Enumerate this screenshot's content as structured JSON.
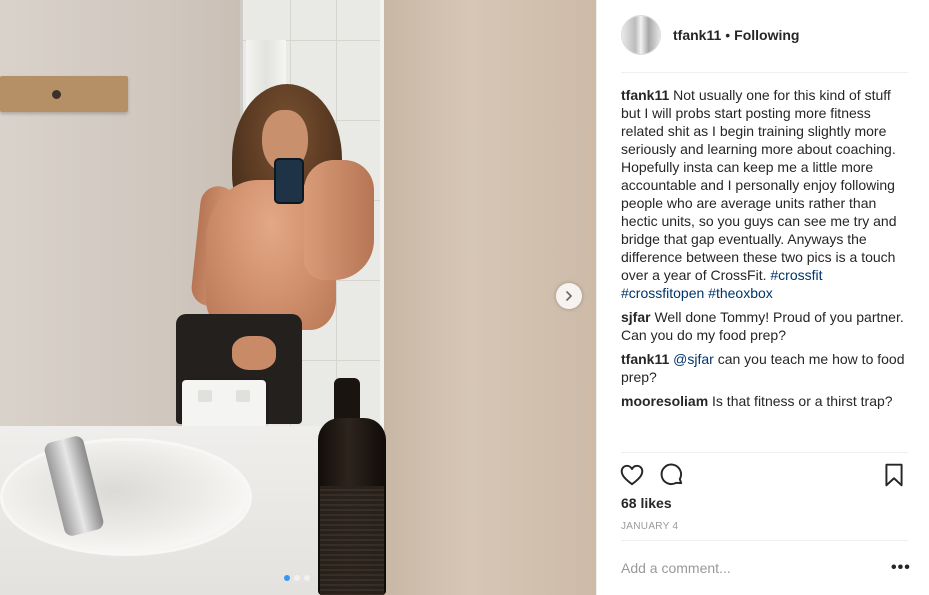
{
  "post": {
    "username": "tfank11",
    "separator": "•",
    "follow_status": "Following",
    "likes": "68 likes",
    "date": "JANUARY 4",
    "add_comment_placeholder": "Add a comment...",
    "more_options": "•••",
    "carousel_dots": 3,
    "carousel_active_index": 0
  },
  "caption": {
    "user": "tfank11",
    "text": "Not usually one for this kind of stuff but I will probs start posting more fitness related shit as I begin training slightly more seriously and learning more about coaching. Hopefully insta can keep me a little more accountable and I personally enjoy following people who are average units rather than hectic units, so you guys can see me try and bridge that gap eventually. Anyways the difference between these two pics is a touch over a year of CrossFit.",
    "tags": [
      "#crossfit",
      "#crossfitopen",
      "#theoxbox"
    ]
  },
  "comments": [
    {
      "user": "sjfar",
      "mention": "",
      "text": "Well done Tommy! Proud of you partner. Can you do my food prep?"
    },
    {
      "user": "tfank11",
      "mention": "@sjfar",
      "text": "can you teach me how to food prep?"
    },
    {
      "user": "mooresoliam",
      "mention": "",
      "text": "Is that fitness or a thirst trap?"
    }
  ],
  "icons": {
    "like": "heart-icon",
    "comment": "comment-icon",
    "save": "bookmark-icon",
    "next": "chevron-right-icon"
  },
  "colors": {
    "link": "#003569",
    "muted": "#999999",
    "text": "#262626",
    "dot_active": "#3897f0"
  }
}
